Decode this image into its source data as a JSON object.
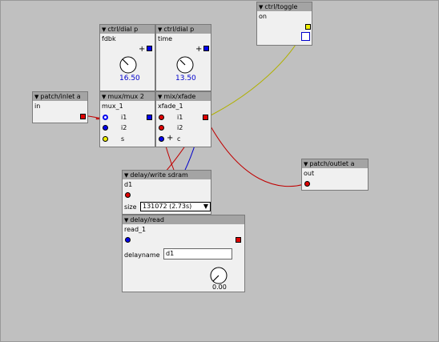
{
  "objects": {
    "dial_fdbk": {
      "type": "ctrl/dial p",
      "name": "fdbk",
      "value": "16.50"
    },
    "dial_time": {
      "type": "ctrl/dial p",
      "name": "time",
      "value": "13.50"
    },
    "toggle_on": {
      "type": "ctrl/toggle",
      "name": "on"
    },
    "inlet_in": {
      "type": "patch/inlet a",
      "name": "in"
    },
    "mux": {
      "type": "mux/mux 2",
      "name": "mux_1",
      "ports": [
        "i1",
        "i2",
        "s"
      ]
    },
    "xfade": {
      "type": "mix/xfade",
      "name": "xfade_1",
      "ports": [
        "i1",
        "i2",
        "c"
      ]
    },
    "outlet_out": {
      "type": "patch/outlet a",
      "name": "out"
    },
    "write": {
      "type": "delay/write sdram",
      "name": "d1",
      "size_label": "size",
      "size_value": "131072 (2.73s)"
    },
    "read": {
      "type": "delay/read",
      "name": "read_1",
      "param_label": "delayname",
      "param_value": "d1",
      "dial_value": "0.00"
    }
  },
  "symbols": {
    "plus": "+",
    "triangle": "▼",
    "dropdown": "▼"
  },
  "colors": {
    "audio": "#e00000",
    "control": "#0000ee",
    "bool": "#f0f000",
    "header": "#a4a4a4"
  }
}
